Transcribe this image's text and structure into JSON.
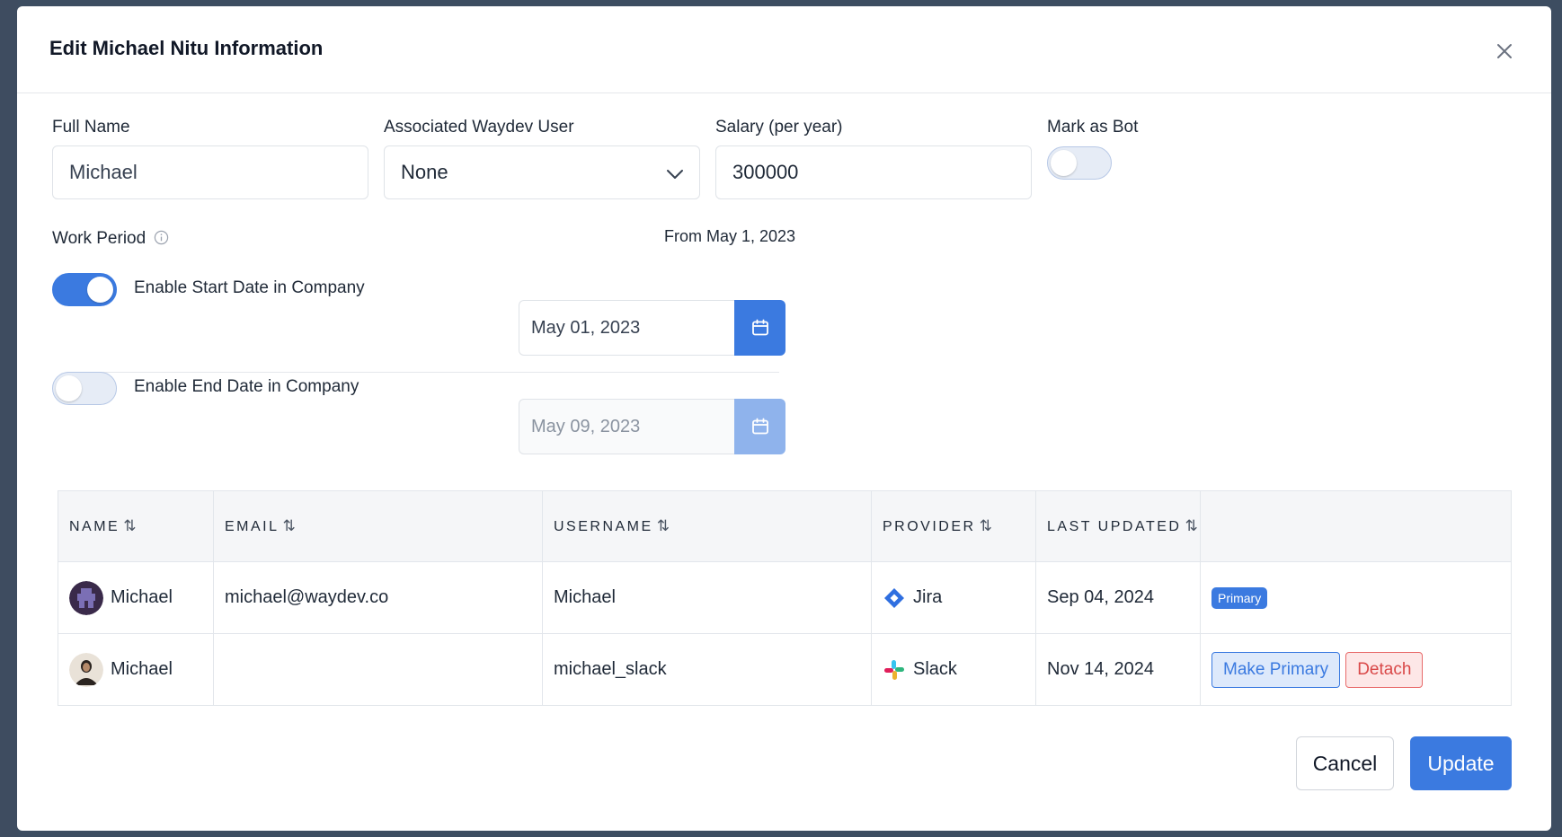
{
  "modal": {
    "title": "Edit Michael Nitu Information"
  },
  "form": {
    "full_name_label": "Full Name",
    "full_name_value": "Michael",
    "associated_user_label": "Associated Waydev User",
    "associated_user_value": "None",
    "salary_label": "Salary (per year)",
    "salary_value": "300000",
    "mark_bot_label": "Mark as Bot",
    "mark_bot_enabled": false
  },
  "work_period": {
    "label": "Work Period",
    "from_text": "From May 1, 2023",
    "start": {
      "label": "Enable Start Date in Company",
      "enabled": true,
      "date": "May 01, 2023"
    },
    "end": {
      "label": "Enable End Date in Company",
      "enabled": false,
      "date": "May 09, 2023"
    }
  },
  "table": {
    "headers": [
      "NAME",
      "EMAIL",
      "USERNAME",
      "PROVIDER",
      "LAST UPDATED",
      ""
    ],
    "sort_glyph": "⇅",
    "rows": [
      {
        "name": "Michael",
        "email": "michael@waydev.co",
        "username": "Michael",
        "provider": "Jira",
        "provider_icon": "jira-icon",
        "last_updated": "Sep 04, 2024",
        "primary_badge": "Primary"
      },
      {
        "name": "Michael",
        "email": "",
        "username": "michael_slack",
        "provider": "Slack",
        "provider_icon": "slack-icon",
        "last_updated": "Nov 14, 2024",
        "make_primary": "Make Primary",
        "detach": "Detach"
      }
    ]
  },
  "footer": {
    "cancel": "Cancel",
    "update": "Update"
  },
  "colors": {
    "accent": "#3b7ae0",
    "danger": "#d94848"
  }
}
